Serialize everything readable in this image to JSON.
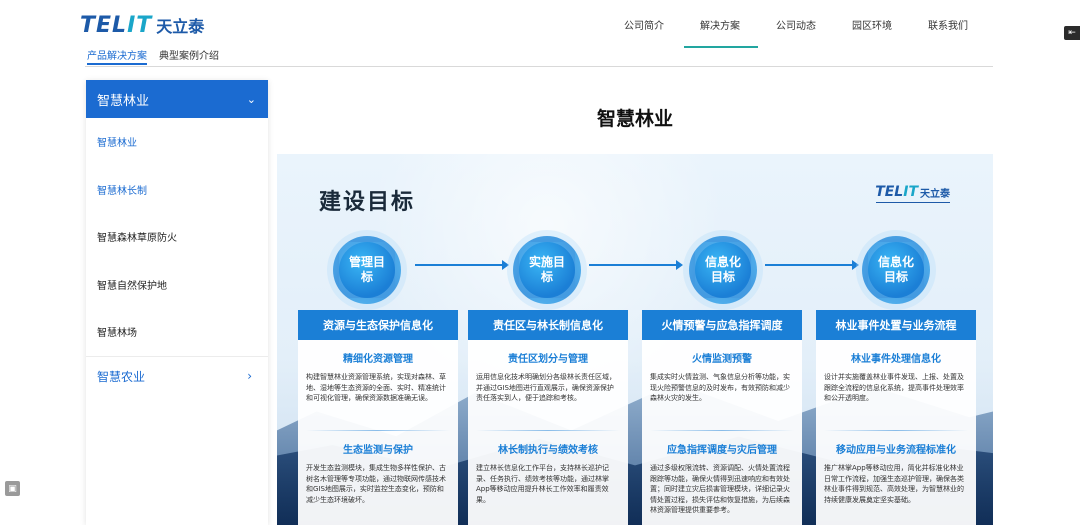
{
  "header": {
    "logo_en_a": "TEL",
    "logo_en_b": "IT",
    "logo_cn": "天立泰",
    "nav": [
      "公司简介",
      "解决方案",
      "公司动态",
      "园区环境",
      "联系我们"
    ],
    "active_nav": "解决方案",
    "subtabs": [
      "产品解决方案",
      "典型案例介绍"
    ],
    "active_subtab": "产品解决方案"
  },
  "sidebar": {
    "section_title": "智慧林业",
    "items": [
      "智慧林业",
      "智慧林长制",
      "智慧森林草原防火",
      "智慧自然保护地",
      "智慧林场"
    ],
    "next_section": "智慧农业"
  },
  "main": {
    "title": "智慧林业",
    "banner": {
      "title": "建设目标",
      "goals": [
        "管理目标",
        "实施目标",
        "信息化目标",
        "信息化目标"
      ],
      "cards": [
        {
          "caption": "资源与生态保护信息化",
          "blocks": [
            {
              "heading": "精细化资源管理",
              "text": "构建智慧林业资源管理系统，实现对森林、草地、湿地等生态资源的全面、实时、精准统计和可视化管理，确保资源数据准确无误。"
            },
            {
              "heading": "生态监测与保护",
              "text": "开发生态监测模块，集成生物多样性保护、古树名木管理等专项功能，通过物联网传感技术和GIS地图展示，实时监控生态变化，预防和减少生态环境破坏。"
            }
          ]
        },
        {
          "caption": "责任区与林长制信息化",
          "blocks": [
            {
              "heading": "责任区划分与管理",
              "text": "运用信息化技术明确划分各级林长责任区域，并通过GIS地图进行直观展示，确保资源保护责任落实到人，便于追踪和考核。"
            },
            {
              "heading": "林长制执行与绩效考核",
              "text": "建立林长信息化工作平台，支持林长巡护记录、任务执行、绩效考核等功能，通过林掌App等移动应用提升林长工作效率和履责效果。"
            }
          ]
        },
        {
          "caption": "火情预警与应急指挥调度",
          "blocks": [
            {
              "heading": "火情监测预警",
              "text": "集成实时火情监测、气象信息分析等功能，实现火险预警信息的及时发布，有效预防和减少森林火灾的发生。"
            },
            {
              "heading": "应急指挥调度与灾后管理",
              "text": "通过多级权限流转、资源调配、火情处置流程跟踪等功能，确保火情得到迅速响应和有效处置；同时建立灾后损害管理模块，详细记录火情处置过程，损失评估和恢复措施，为后续森林资源管理提供重要参考。"
            }
          ]
        },
        {
          "caption": "林业事件处置与业务流程",
          "blocks": [
            {
              "heading": "林业事件处理信息化",
              "text": "设计并实施覆盖林业事件发现、上报、处置及跟踪全流程的信息化系统，提高事件处理效率和公开透明度。"
            },
            {
              "heading": "移动应用与业务流程标准化",
              "text": "推广林掌App等移动应用，简化并标准化林业日常工作流程，加强生态巡护管理，确保各类林业事件得到规范、高效处理，为智慧林业的持续健康发展奠定坚实基础。"
            }
          ]
        }
      ]
    }
  },
  "colors": {
    "accent": "#1b6bd1",
    "nav_underline": "#22a6a0",
    "banner_blue": "#1b7fd6"
  },
  "icons": {
    "sidebar_head": "chevron-down-icon",
    "sidebar_foot": "chevron-right-icon",
    "top_right": "collapse-icon",
    "bottom_left": "float-tool-icon"
  }
}
